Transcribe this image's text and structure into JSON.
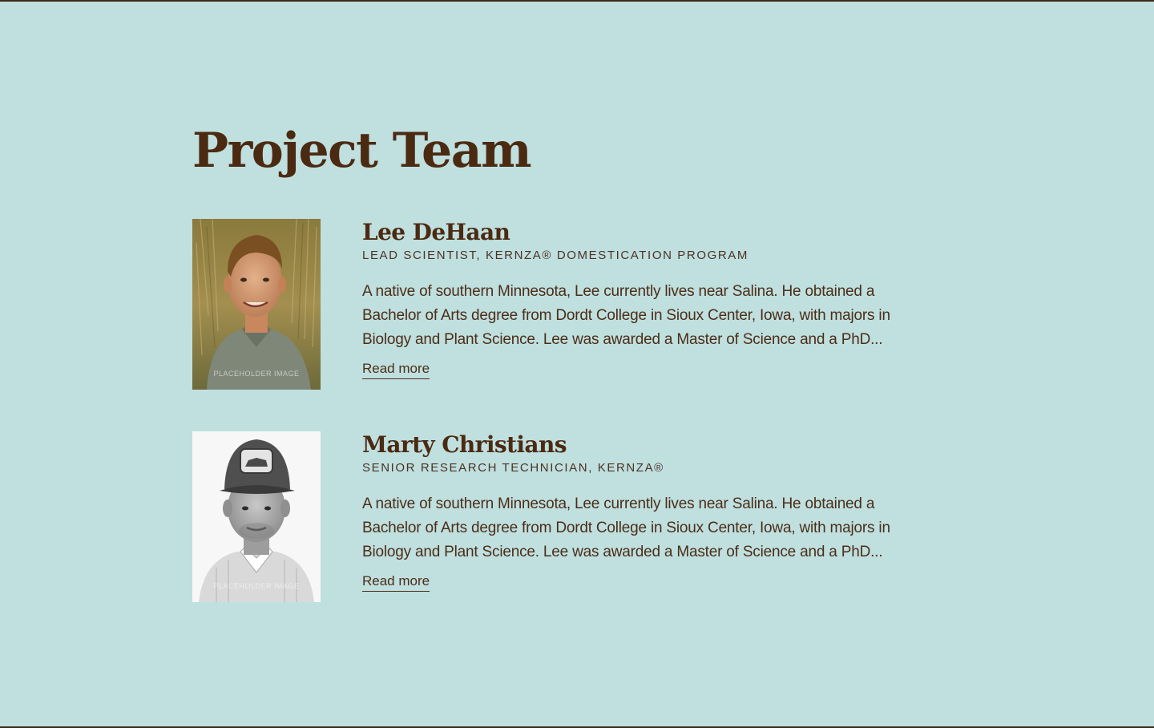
{
  "section": {
    "title": "Project Team"
  },
  "members": [
    {
      "name": "Lee DeHaan",
      "role": "LEAD SCIENTIST, KERNZA® DOMESTICATION PROGRAM",
      "bio": "A native of southern Minnesota, Lee currently lives near Salina. He obtained a Bachelor of Arts degree from Dordt College in Sioux Center, Iowa, with majors in Biology and Plant Science. Lee was awarded a Master of Science and a PhD...",
      "read_more": "Read more",
      "photo_watermark": "PLACEHOLDER IMAGE"
    },
    {
      "name": "Marty Christians",
      "role": "SENIOR RESEARCH TECHNICIAN, KERNZA®",
      "bio": "A native of southern Minnesota, Lee currently lives near Salina. He obtained a Bachelor of Arts degree from Dordt College in Sioux Center, Iowa, with majors in Biology and Plant Science. Lee was awarded a Master of Science and a PhD...",
      "read_more": "Read more",
      "photo_watermark": "PLACEHOLDER IMAGE"
    }
  ],
  "colors": {
    "background": "#c0dfdf",
    "heading": "#4b2a12",
    "text": "#4a2e18",
    "border": "#3b2a1c"
  }
}
